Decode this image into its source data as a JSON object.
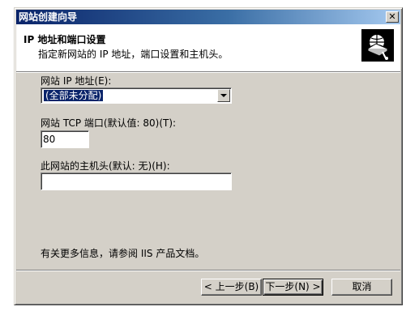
{
  "window": {
    "title": "网站创建向导",
    "close_glyph": "✕"
  },
  "header": {
    "title": "IP 地址和端口设置",
    "subtitle": "指定新网站的 IP 地址，端口设置和主机头。",
    "icon": "iis-website-wizard-icon"
  },
  "fields": {
    "ip_label": "网站 IP 地址(E):",
    "ip_value": "(全部未分配)",
    "port_label": "网站 TCP 端口(默认值: 80)(T):",
    "port_value": "80",
    "host_label": "此网站的主机头(默认: 无)(H):",
    "host_value": ""
  },
  "info_text": "有关更多信息，请参阅 IIS 产品文档。",
  "buttons": {
    "back": "< 上一步(B)",
    "next": "下一步(N) >",
    "cancel": "取消"
  }
}
